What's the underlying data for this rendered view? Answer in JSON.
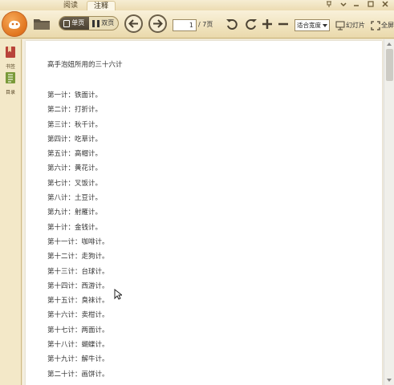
{
  "tabs": [
    {
      "label": "阅读"
    },
    {
      "label": "注释"
    }
  ],
  "window_controls": [
    "pin-icon",
    "menu-icon",
    "minimize-icon",
    "maximize-icon",
    "close-icon"
  ],
  "toolbar": {
    "single_page": "单页",
    "double_page": "双页",
    "page_current": "1",
    "page_total": "/ 7页",
    "zoom_mode": "适合宽度",
    "slideshow": "幻灯片",
    "fullscreen": "全屏"
  },
  "sidebar": {
    "items": [
      {
        "label": "书签",
        "icon": "bookmark-icon"
      },
      {
        "label": "目录",
        "icon": "toc-icon"
      }
    ]
  },
  "document": {
    "title": "高手泡妞所用的三十六计",
    "items": [
      "第一计：铁面计。",
      "第二计：打折计。",
      "第三计：秋千计。",
      "第四计：吃草计。",
      "第五计：高帽计。",
      "第六计：黄花计。",
      "第七计：叉饭计。",
      "第八计：土豆计。",
      "第九计：射雁计。",
      "第十计：金钱计。",
      "第十一计：咖啡计。",
      "第十二计：走狗计。",
      "第十三计：台球计。",
      "第十四计：西游计。",
      "第十五计：臭袜计。",
      "第十六计：卖柑计。",
      "第十七计：两面计。",
      "第十八计：蝴蝶计。",
      "第十九计：解牛计。",
      "第二十计：画饼计。"
    ]
  },
  "colors": {
    "chrome": "#efe4c4",
    "accent": "#e0731c",
    "page": "#ffffff"
  }
}
